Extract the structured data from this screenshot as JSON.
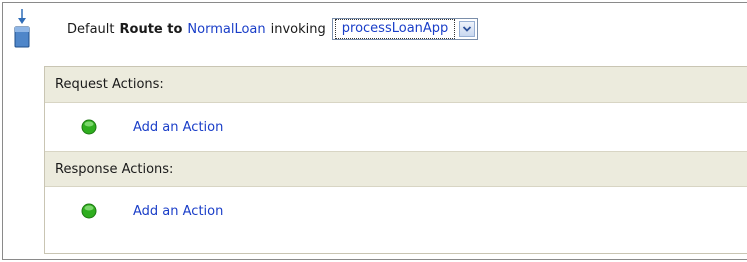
{
  "route": {
    "prefix": "Default",
    "keyword": "Route to",
    "target_service": "NormalLoan",
    "connector": "invoking",
    "operation_select": {
      "selected": "processLoanApp"
    }
  },
  "sections": {
    "request": {
      "title": "Request Actions:",
      "add_action_label": "Add an Action"
    },
    "response": {
      "title": "Response Actions:",
      "add_action_label": "Add an Action"
    }
  },
  "icons": {
    "route_node": "route-node-icon",
    "add_action": "green-dot-icon",
    "dropdown": "chevron-down-icon"
  },
  "colors": {
    "link": "#1a3ec8",
    "section_header_bg": "#ecebdd",
    "add_dot": "#2fae1f",
    "node_icon": "#2f6db8"
  }
}
